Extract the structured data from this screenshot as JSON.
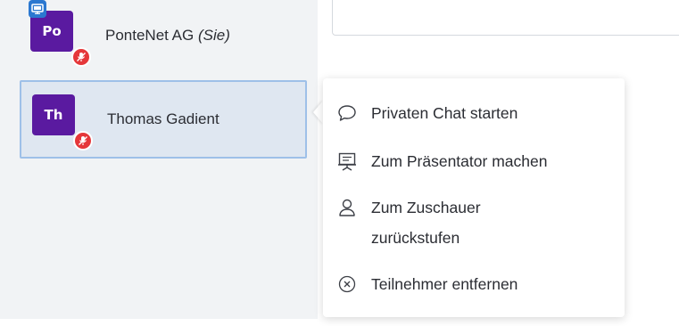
{
  "participants": [
    {
      "initials": "Po",
      "name": "PonteNet AG",
      "suffix": "(Sie)",
      "screen_share": true,
      "mic": "muted"
    },
    {
      "initials": "Th",
      "name": "Thomas Gadient",
      "suffix": "",
      "screen_share": false,
      "mic": "muted"
    }
  ],
  "context_menu": {
    "items": [
      {
        "label": "Privaten Chat starten",
        "icon": "chat-bubble-icon"
      },
      {
        "label": "Zum Präsentator machen",
        "icon": "presentation-icon"
      },
      {
        "label": "Zum Zuschauer",
        "label2": "zurückstufen",
        "icon": "user-icon"
      },
      {
        "label": "Teilnehmer entfernen",
        "icon": "remove-circle-icon"
      }
    ]
  },
  "colors": {
    "avatar": "#5a1aa0",
    "mic_muted": "#e5373a",
    "screen_share": "#2b78d0",
    "selected_border": "#9ec0e8",
    "selected_bg": "#dfe7f1"
  }
}
